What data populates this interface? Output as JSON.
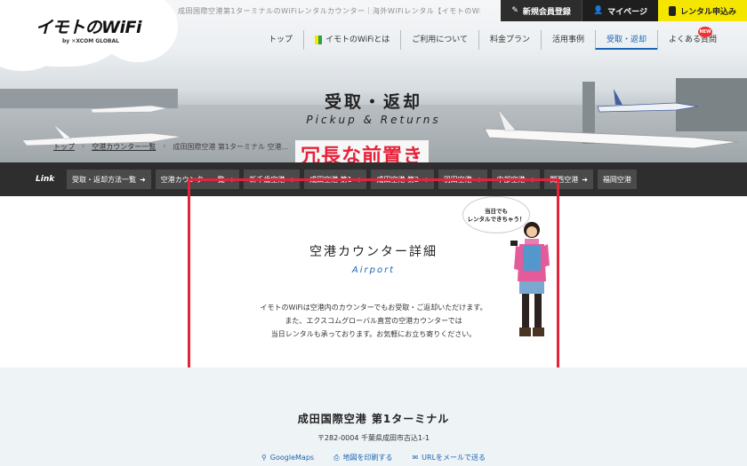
{
  "header": {
    "tagline": "成田国際空港第1ターミナルのWiFiレンタルカウンター｜海外WiFiレンタル【イモトのWi-",
    "logo_main": "イモトのWiFi",
    "logo_sub": "by ✕XCOM GLOBAL",
    "top_buttons": [
      {
        "label": "新規会員登録",
        "icon": "edit-icon"
      },
      {
        "label": "マイページ",
        "icon": "user-icon"
      },
      {
        "label": "レンタル申込み",
        "icon": "wifi-device-icon"
      }
    ],
    "nav": [
      "トップ",
      "イモトのWiFiとは",
      "ご利用について",
      "料金プラン",
      "活用事例",
      "受取・返却",
      "よくある質問"
    ],
    "new_badge": "NEW",
    "active_nav": "受取・返却"
  },
  "hero": {
    "title": "受取・返却",
    "subtitle": "Pickup & Returns",
    "breadcrumb": [
      "トップ",
      "空港カウンター一覧",
      "成田国際空港 第1ターミナル 空港..."
    ]
  },
  "annotation": {
    "label": "冗長な前置き",
    "color": "#e6223a"
  },
  "linkbar": {
    "label": "Link",
    "items": [
      "受取・返却方法一覧",
      "空港カウンター一覧",
      "新千歳空港",
      "成田空港 第1",
      "成田空港 第2",
      "羽田空港",
      "中部空港",
      "関西空港",
      "福岡空港"
    ]
  },
  "section": {
    "title": "空港カウンター詳細",
    "title_en": "Airport",
    "desc": [
      "イモトのWiFiは空港内のカウンターでもお受取・ご返却いただけます。",
      "また、エクスコムグローバル直営の空港カウンターでは",
      "当日レンタルも承っております。お気軽にお立ち寄りください。"
    ],
    "bubble": [
      "当日でも",
      "レンタルできちゃう！"
    ]
  },
  "counter": {
    "name": "成田国際空港 第1ターミナル",
    "address": "〒282-0004 千葉県成田市古込1-1",
    "links": [
      {
        "label": "GoogleMaps",
        "icon": "map-pin-icon"
      },
      {
        "label": "地図を印刷する",
        "icon": "print-icon"
      },
      {
        "label": "URLをメールで送る",
        "icon": "mail-icon"
      }
    ]
  },
  "colors": {
    "accent_blue": "#1b64b3",
    "link_bar": "#2e2e2e",
    "yellow": "#f5e600",
    "annotation_red": "#e6223a"
  }
}
